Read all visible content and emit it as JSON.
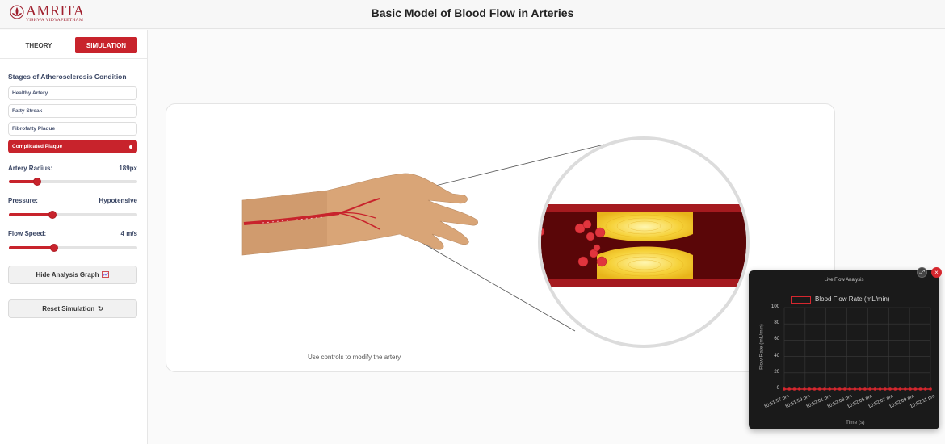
{
  "header": {
    "logo_name": "AMRITA",
    "logo_sub": "VISHWA VIDYAPEETHAM",
    "title": "Basic Model of Blood Flow in Arteries"
  },
  "sidebar": {
    "tabs": [
      "THEORY",
      "SIMULATION"
    ],
    "active_tab": "SIMULATION",
    "stages_title": "Stages of Atherosclerosis Condition",
    "stages": [
      "Healthy Artery",
      "Fatty Streak",
      "Fibrofatty Plaque",
      "Complicated Plaque"
    ],
    "active_stage": "Complicated Plaque",
    "controls": {
      "radius": {
        "label": "Artery Radius:",
        "value": "189px",
        "level": 0.22
      },
      "pressure": {
        "label": "Pressure:",
        "value": "Hypotensive",
        "level": 0.34
      },
      "speed": {
        "label": "Flow Speed:",
        "value": "4 m/s",
        "level": 0.35
      }
    },
    "hide_graph_label": "Hide Analysis Graph",
    "reset_label": "Reset Simulation"
  },
  "main": {
    "caption": "Use controls to modify the artery"
  },
  "graph": {
    "title": "Live Flow Analysis",
    "colors": {
      "series": "#d6272e",
      "background": "#1a1a1a",
      "accent": "#c8232c"
    }
  },
  "chart_data": {
    "type": "line",
    "title": "Live Flow Analysis",
    "xlabel": "Time (s)",
    "ylabel": "Flow Rate (mL/min)",
    "ylim": [
      0,
      100
    ],
    "yticks": [
      0,
      20,
      40,
      60,
      80,
      100
    ],
    "x_tick_labels": [
      "10:51:57 pm",
      "10:51:59 pm",
      "10:52:01 pm",
      "10:52:03 pm",
      "10:52:05 pm",
      "10:52:07 pm",
      "10:52:09 pm",
      "10:52:11 pm"
    ],
    "grid": true,
    "legend": "top",
    "series": [
      {
        "name": "Blood Flow Rate (mL/min)",
        "values": [
          0,
          0,
          0,
          0,
          0,
          0,
          0,
          0,
          0,
          0,
          0,
          0,
          0,
          0,
          0,
          0,
          0,
          0,
          0,
          0,
          0,
          0,
          0,
          0,
          0,
          0,
          0,
          0,
          0,
          0
        ]
      }
    ]
  }
}
